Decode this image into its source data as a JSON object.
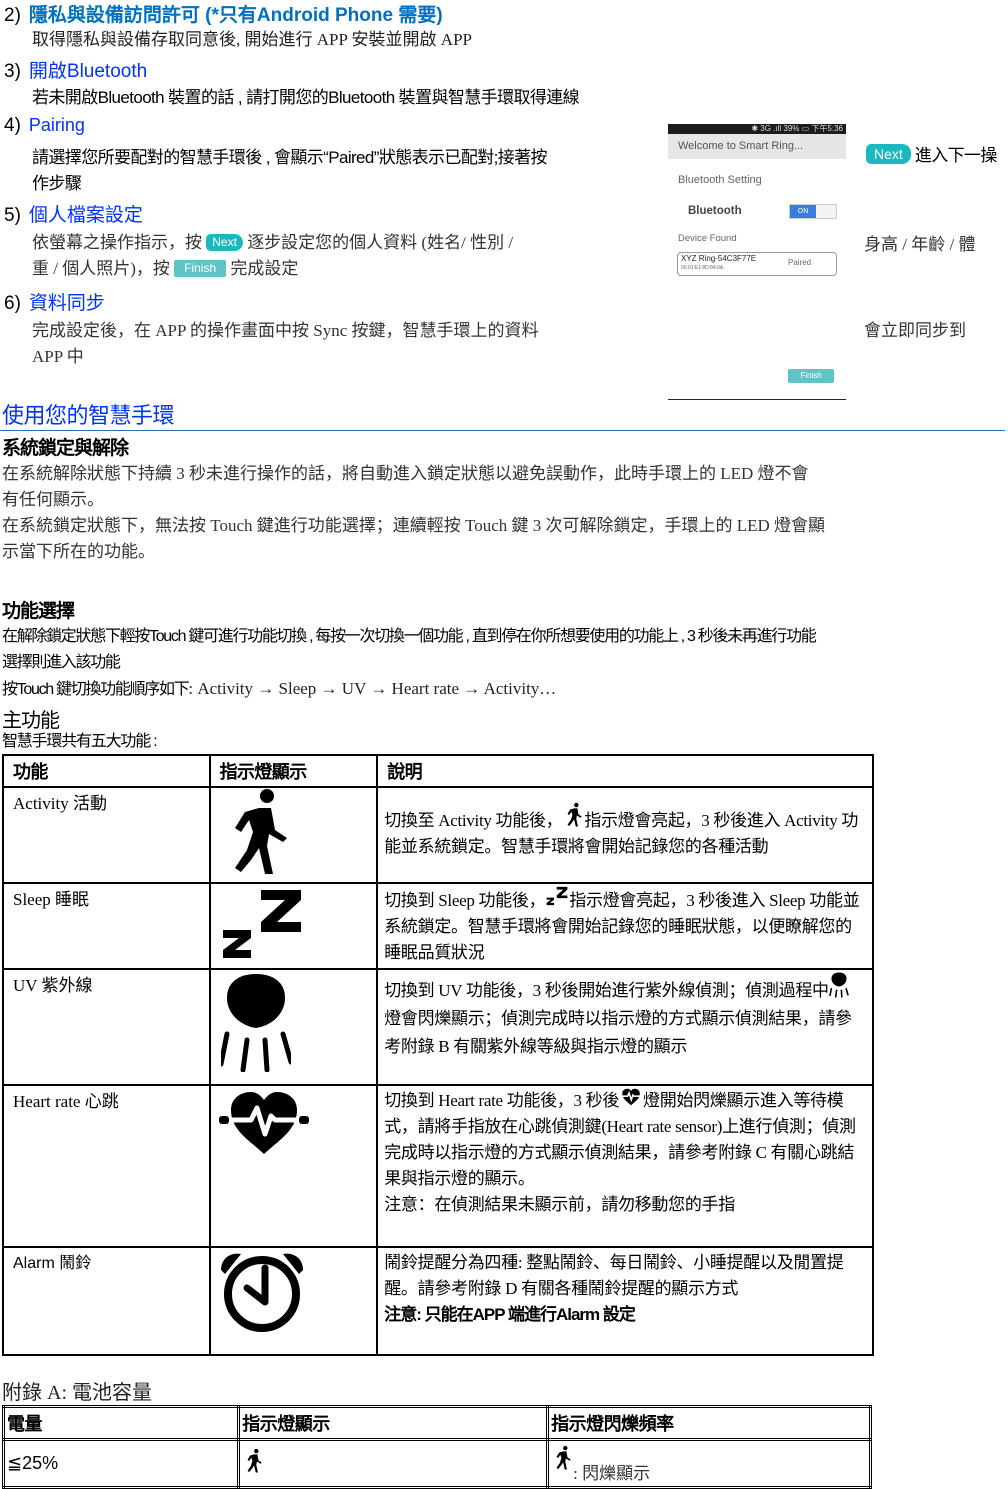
{
  "setup_steps": [
    {
      "num": "2)",
      "title": "隱私與設備訪問許可 (*只有Android Phone 需要)",
      "body": "取得隱私與設備存取同意後, 開始進行 APP 安裝並開啟 APP"
    },
    {
      "num": "3)",
      "title": "開啟Bluetooth",
      "body": "若未開啟Bluetooth 裝置的話 , 請打開您的Bluetooth 裝置與智慧手環取得連線"
    },
    {
      "num": "4)",
      "title": "Pairing",
      "body_line1": "請選擇您所要配對的智慧手環後 , 會顯示“Paired”狀態表示已配對;接著按",
      "body_line2": "作步驟",
      "right_text": "進入下一操"
    },
    {
      "num": "5)",
      "title": "個人檔案設定",
      "body_a": "依螢幕之操作指示，按",
      "body_b": "逐步設定您的個人資料 (姓名/ 性別 /",
      "body_line2_a": "重 / 個人照片)，按",
      "body_line2_b": "完成設定",
      "right_text": "身高 / 年齡 / 體"
    },
    {
      "num": "6)",
      "title": "資料同步",
      "body_line1": "完成設定後，在 APP 的操作畫面中按 Sync 按鍵，智慧手環上的資料",
      "body_line2": "APP 中",
      "right_text": "會立即同步到"
    }
  ],
  "buttons": {
    "next": "Next",
    "finish": "Finish"
  },
  "phone": {
    "status_bar": "✱ 3G .ıll 39% ▭ 下午5:36",
    "title_bar": "Welcome to Smart Ring...",
    "section": "Bluetooth Setting",
    "bluetooth_label": "Bluetooth",
    "toggle": "ON",
    "device_found": "Device Found",
    "device_name": "XYZ Ring-54C3F77E",
    "device_mac": "00:01:E1:8D:84:0A",
    "device_status": "Paired",
    "finish": "Finish"
  },
  "section_title": "使用您的智慧手環",
  "lock": {
    "heading": "系統鎖定與解除",
    "p1_line1": "在系統解除狀態下持續 3 秒未進行操作的話，將自動進入鎖定狀態以避免誤動作，此時手環上的 LED 燈不會",
    "p1_line2": "有任何顯示。",
    "p2_line1": "在系統鎖定狀態下，無法按 Touch 鍵進行功能選擇；連續輕按 Touch 鍵 3 次可解除鎖定，手環上的 LED 燈會顯",
    "p2_line2": "示當下所在的功能。"
  },
  "select": {
    "heading": "功能選擇",
    "line1": "在解除鎖定狀態下輕按Touch 鍵可進行功能切換 , 每按一次切換一個功能 , 直到停在你所想要使用的功能上 , 3 秒後未再進行功能",
    "line2": "選擇則進入該功能",
    "line3_a": "按Touch 鍵切換功能順序如下",
    "line3_b": ": Activity → Sleep → UV → Heart rate → Activity…"
  },
  "main": {
    "heading": "主功能",
    "intro": "智慧手環共有五大功能 :"
  },
  "func_table": {
    "headers": [
      "功能",
      "指示燈顯示",
      "說明"
    ],
    "rows": [
      {
        "name": "Activity 活動",
        "icon": "running-person-icon",
        "desc_a": "切換至 Activity 功能後，",
        "desc_b": "指示燈會亮起，3 秒後進入 Activity 功能並系統鎖定。智慧手環將會開始記錄您的各種活動"
      },
      {
        "name": "Sleep 睡眠",
        "icon": "sleep-zz-icon",
        "desc_a": "切換到 Sleep 功能後，",
        "desc_b": "指示燈會亮起，3 秒後進入 Sleep 功能並系統鎖定。智慧手環將會開始記錄您的睡眠狀態，以便瞭解您的睡眠品質狀況"
      },
      {
        "name": "UV 紫外線",
        "icon": "uv-sun-icon",
        "desc_a": "切換到 UV 功能後，3 秒後開始進行紫外線偵測；偵測過程中",
        "desc_b": "燈會閃爍顯示；偵測完成時以指示燈的方式顯示偵測結果，請參考附錄 B 有關紫外線等級與指示燈的顯示"
      },
      {
        "name": "Heart rate 心跳",
        "icon": "heart-rate-icon",
        "desc_a": "切換到 Heart rate 功能後，3 秒後",
        "desc_b": "燈開始閃爍顯示進入等待模式，請將手指放在心跳偵測鍵(Heart rate sensor)上進行偵測；偵測完成時以指示燈的方式顯示偵測結果，請參考附錄 C 有關心跳結果與指示燈的顯示。",
        "note": "注意：在偵測結果未顯示前，請勿移動您的手指"
      },
      {
        "name": "Alarm 鬧鈴",
        "icon": "alarm-clock-icon",
        "desc_a": "鬧鈴提醒分為四種: 整點鬧鈴、每日鬧鈴、小睡提醒以及閒置提醒。請參考附錄 D 有關各種鬧鈴提醒的顯示方式",
        "note": "注意: 只能在APP 端進行Alarm 設定"
      }
    ]
  },
  "appendix_a": {
    "title": "附錄 A: 電池容量",
    "headers": [
      "電量",
      "指示燈顯示",
      "指示燈閃爍頻率"
    ],
    "rows": [
      {
        "level": "≦25%",
        "icon": "running-person-icon",
        "freq": ": 閃爍顯示"
      }
    ]
  },
  "colors": {
    "heading_blue": "#0033ff",
    "step_blue": "#0070c0",
    "rule_blue": "#2e74b5",
    "teal_button": "#1cb8c0"
  }
}
